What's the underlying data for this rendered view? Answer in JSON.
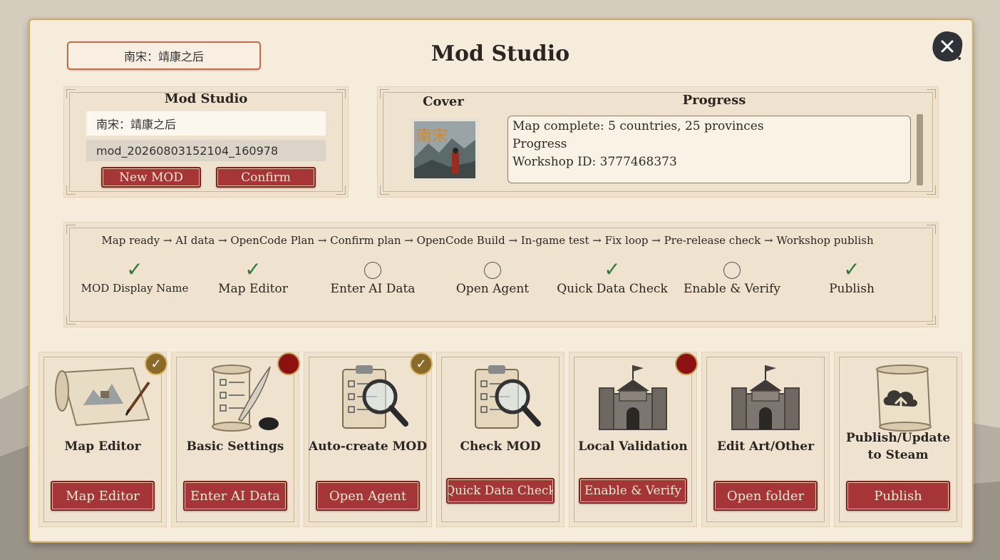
{
  "header": {
    "mod_name": "南宋：靖康之后",
    "title": "Mod Studio"
  },
  "studio": {
    "title": "Mod Studio",
    "name_value": "南宋：靖康之后",
    "id_value": "mod_20260803152104_160978",
    "new_button": "New MOD",
    "confirm_button": "Confirm"
  },
  "cover": {
    "title": "Cover",
    "image_text": "南宋"
  },
  "progress": {
    "title": "Progress",
    "lines": [
      "Map complete: 5 countries, 25 provinces",
      "Progress",
      "Workshop ID: 3777468373"
    ]
  },
  "pipeline": {
    "text": "Map ready → AI data → OpenCode Plan → Confirm plan → OpenCode Build → In-game test → Fix loop → Pre-release check → Workshop publish",
    "steps": [
      {
        "label": "MOD Display Name",
        "done": true
      },
      {
        "label": "Map Editor",
        "done": true
      },
      {
        "label": "Enter AI Data",
        "done": false
      },
      {
        "label": "Open Agent",
        "done": false
      },
      {
        "label": "Quick Data Check",
        "done": true
      },
      {
        "label": "Enable & Verify",
        "done": false
      },
      {
        "label": "Publish",
        "done": true
      }
    ]
  },
  "cards": [
    {
      "title": "Map Editor",
      "button": "Map Editor",
      "badge": "check",
      "icon": "map-scroll-icon"
    },
    {
      "title": "Basic Settings",
      "button": "Enter AI Data",
      "badge": "red",
      "icon": "scroll-quill-icon"
    },
    {
      "title": "Auto-create MOD",
      "button": "Open Agent",
      "badge": "check",
      "icon": "clipboard-magnifier-icon"
    },
    {
      "title": "Check MOD",
      "button": "Quick Data Check",
      "badge": "none",
      "icon": "clipboard-magnifier-icon"
    },
    {
      "title": "Local Validation",
      "button": "Enable & Verify",
      "badge": "red",
      "icon": "fortress-icon"
    },
    {
      "title": "Edit Art/Other",
      "button": "Open folder",
      "badge": "none",
      "icon": "fortress-icon"
    },
    {
      "title": "Publish/Update to Steam",
      "button": "Publish",
      "badge": "none",
      "icon": "cloud-upload-scroll-icon"
    }
  ],
  "colors": {
    "accent_red": "#a53536",
    "panel_bg": "#f6ecdc",
    "check_green": "#2f7a3a",
    "badge_gold": "#8a6a2a"
  }
}
